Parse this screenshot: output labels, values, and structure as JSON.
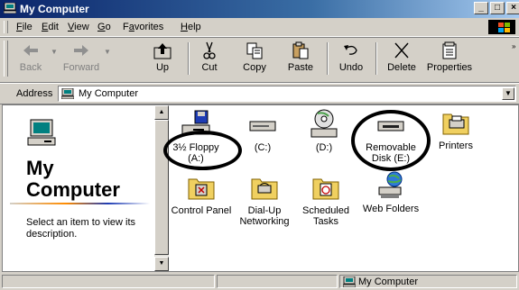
{
  "window": {
    "title": "My Computer"
  },
  "menu": [
    "File",
    "Edit",
    "View",
    "Go",
    "Favorites",
    "Help"
  ],
  "menu_underline": [
    "F",
    "E",
    "V",
    "G",
    "a",
    "H"
  ],
  "toolbar": {
    "back": "Back",
    "forward": "Forward",
    "up": "Up",
    "cut": "Cut",
    "copy": "Copy",
    "paste": "Paste",
    "undo": "Undo",
    "delete": "Delete",
    "properties": "Properties"
  },
  "address": {
    "label": "Address",
    "value": "My Computer"
  },
  "left_pane": {
    "title_line1": "My",
    "title_line2": "Computer",
    "hint": "Select an item to view its description."
  },
  "items": [
    {
      "label": "3½ Floppy (A:)",
      "icon": "floppy-drive-icon"
    },
    {
      "label": "(C:)",
      "icon": "hard-drive-icon"
    },
    {
      "label": "(D:)",
      "icon": "cd-drive-icon"
    },
    {
      "label": "Removable Disk (E:)",
      "icon": "removable-disk-icon"
    },
    {
      "label": "Printers",
      "icon": "printers-folder-icon"
    },
    {
      "label": "Control Panel",
      "icon": "control-panel-icon"
    },
    {
      "label": "Dial-Up Networking",
      "icon": "dialup-networking-icon"
    },
    {
      "label": "Scheduled Tasks",
      "icon": "scheduled-tasks-icon"
    },
    {
      "label": "Web Folders",
      "icon": "web-folders-icon"
    }
  ],
  "status": {
    "zone": "My Computer"
  },
  "colors": {
    "titlebar": "#0a246a",
    "face": "#d4d0c8",
    "annotation": "#000000"
  }
}
